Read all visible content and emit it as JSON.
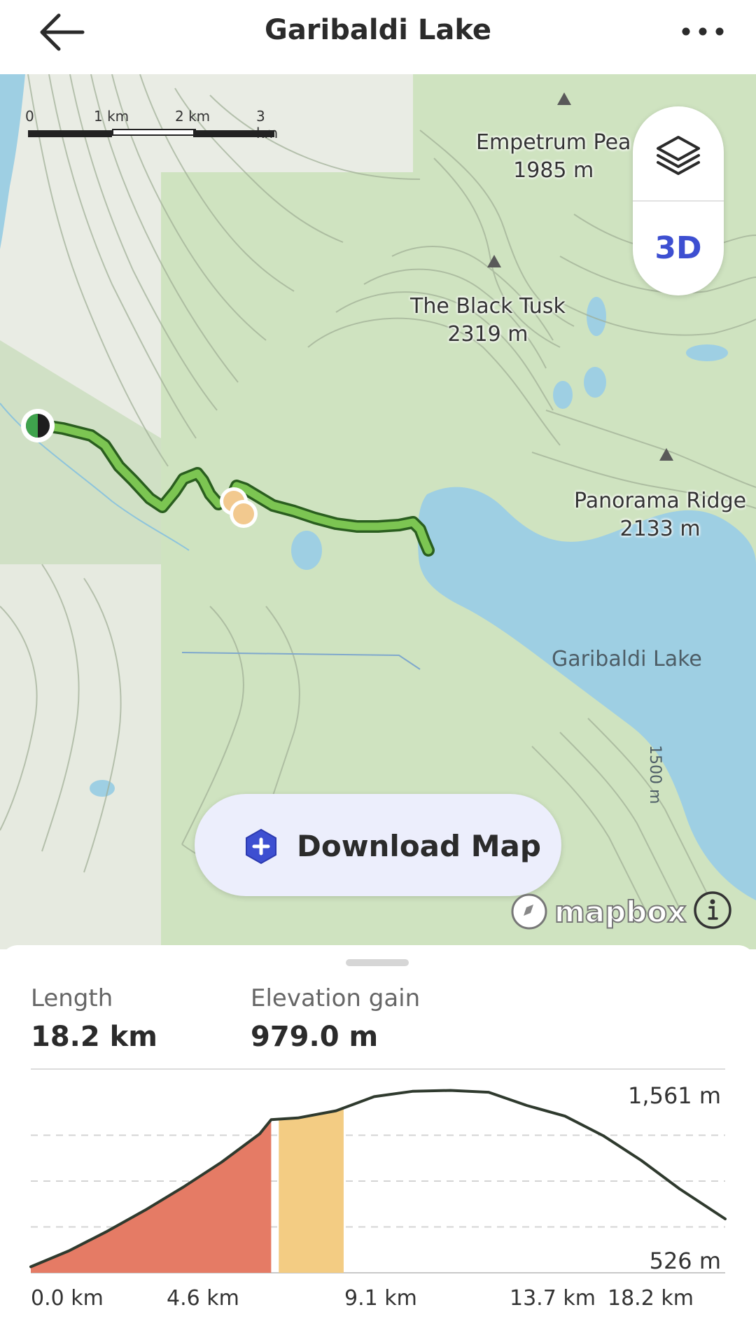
{
  "header": {
    "title": "Garibaldi Lake",
    "back_icon": "arrow-left-icon",
    "more_icon": "more-horizontal-icon"
  },
  "map": {
    "scale_labels": [
      "0",
      "1 km",
      "2 km",
      "3 km"
    ],
    "peaks": [
      {
        "name": "Empetrum Pea",
        "elevation": "1985 m"
      },
      {
        "name": "The Black Tusk",
        "elevation": "2319 m"
      },
      {
        "name": "Panorama Ridge",
        "elevation": "2133 m"
      }
    ],
    "lake_label": "Garibaldi Lake",
    "contour_label": "1500 m",
    "layers_icon": "layers-icon",
    "mode_3d_label": "3D",
    "download_label": "Download Map",
    "download_icon": "download-plus-hex-icon",
    "attribution": "mapbox",
    "info_icon": "info-icon",
    "trail_color": "#7cc552",
    "lake_color": "#9ecfe3"
  },
  "stats": {
    "length_label": "Length",
    "length_value": "18.2 km",
    "gain_label": "Elevation gain",
    "gain_value": "979.0 m"
  },
  "chart_data": {
    "type": "area",
    "y_max_label": "1,561 m",
    "y_min_label": "526 m",
    "x_tick_labels": [
      "0.0 km",
      "4.6 km",
      "9.1 km",
      "13.7 km",
      "18.2 km"
    ],
    "x_km": [
      0.0,
      1.0,
      2.0,
      3.0,
      4.0,
      5.0,
      6.0,
      6.3,
      7.0,
      8.0,
      9.0,
      10.0,
      11.0,
      12.0,
      13.0,
      14.0,
      15.0,
      16.0,
      17.0,
      18.2
    ],
    "elevation_m": [
      560,
      650,
      760,
      880,
      1010,
      1150,
      1310,
      1390,
      1400,
      1440,
      1520,
      1550,
      1555,
      1545,
      1470,
      1410,
      1300,
      1160,
      1000,
      830
    ],
    "ylim": [
      526,
      1561
    ],
    "segments": [
      {
        "from_km": 0.0,
        "to_km": 6.3,
        "color": "#e57b65"
      },
      {
        "from_km": 6.5,
        "to_km": 8.2,
        "color": "#f3cc83"
      }
    ],
    "line_color": "#2f3a2e",
    "grid": true
  }
}
